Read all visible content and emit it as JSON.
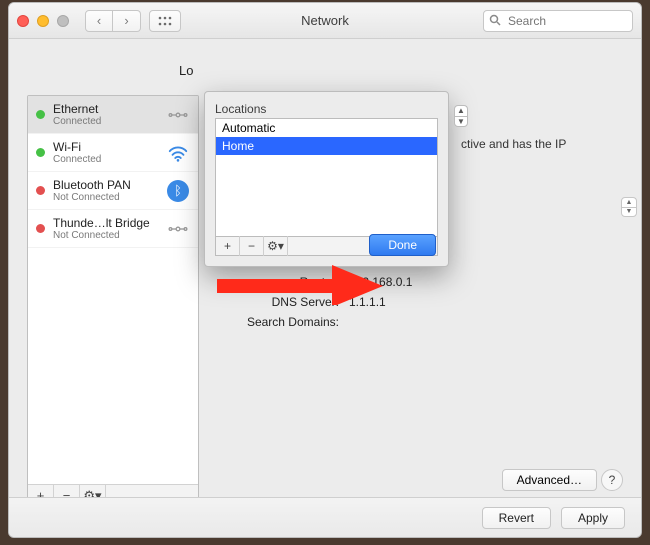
{
  "window": {
    "title": "Network"
  },
  "titlebar": {
    "back_label": "‹",
    "forward_label": "›",
    "grid_label": "⋮⋮⋮",
    "search_placeholder": "Search"
  },
  "location_row": {
    "label": "Lo"
  },
  "sidebar": {
    "items": [
      {
        "name": "Ethernet",
        "status": "Connected",
        "dot": "green",
        "icon": "ethernet"
      },
      {
        "name": "Wi-Fi",
        "status": "Connected",
        "dot": "green",
        "icon": "wifi"
      },
      {
        "name": "Bluetooth PAN",
        "status": "Not Connected",
        "dot": "red",
        "icon": "bluetooth"
      },
      {
        "name": "Thunde…lt Bridge",
        "status": "Not Connected",
        "dot": "red",
        "icon": "ethernet"
      }
    ],
    "footer": {
      "add": "+",
      "remove": "−",
      "menu": "⚙︎▾"
    }
  },
  "info": {
    "status_fragment": "ctive and has the IP",
    "rows": [
      {
        "label": "Router:",
        "value": "192.168.0.1"
      },
      {
        "label": "DNS Server:",
        "value": "1.1.1.1"
      },
      {
        "label": "Search Domains:",
        "value": ""
      }
    ]
  },
  "buttons": {
    "advanced": "Advanced…",
    "help": "?",
    "revert": "Revert",
    "apply": "Apply"
  },
  "popover": {
    "label": "Locations",
    "items": [
      "Automatic",
      "Home"
    ],
    "selected_index": 1,
    "footer": {
      "add": "+",
      "remove": "−",
      "menu": "⚙︎▾"
    },
    "done": "Done"
  }
}
